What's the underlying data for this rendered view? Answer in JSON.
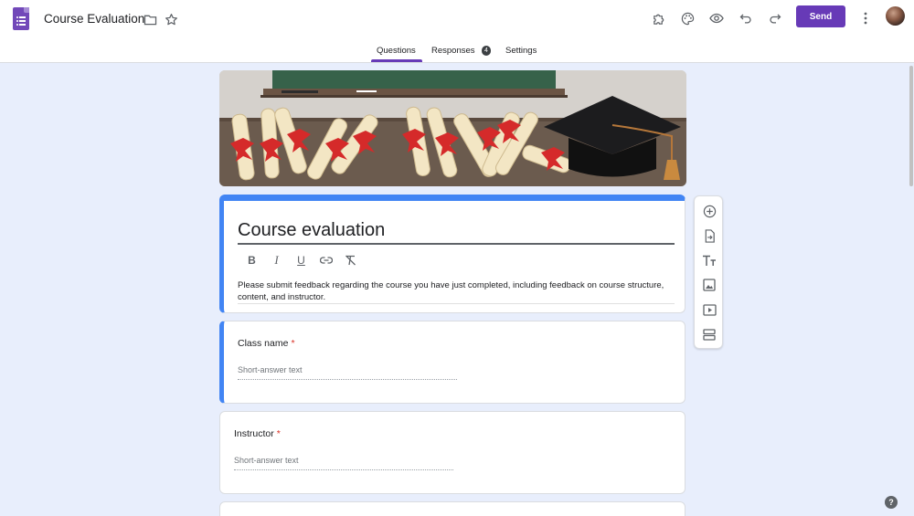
{
  "header": {
    "doc_title": "Course Evaluation",
    "send_label": "Send",
    "accent_color": "#673ab7",
    "icons": [
      "forms-app-icon",
      "folder-icon",
      "star-icon",
      "addon-puzzle-icon",
      "palette-icon",
      "eye-preview-icon",
      "undo-icon",
      "redo-icon",
      "more-vert-icon"
    ]
  },
  "tabs": {
    "questions": "Questions",
    "responses": "Responses",
    "responses_count": "4",
    "settings": "Settings",
    "active": "Questions"
  },
  "form": {
    "title": "Course evaluation",
    "description": "Please submit feedback regarding the course you have just completed, including feedback on course structure, content, and instructor.",
    "format_tools": [
      "bold-icon",
      "italic-icon",
      "underline-icon",
      "link-icon",
      "clear-format-icon"
    ]
  },
  "questions": [
    {
      "title": "Class name",
      "required_mark": "*",
      "placeholder": "Short-answer text"
    },
    {
      "title": "Instructor",
      "required_mark": "*",
      "placeholder": "Short-answer text"
    }
  ],
  "side_toolbar": [
    "add-question-icon",
    "import-questions-icon",
    "add-title-icon",
    "add-image-icon",
    "add-video-icon",
    "add-section-icon"
  ],
  "help_label": "?"
}
